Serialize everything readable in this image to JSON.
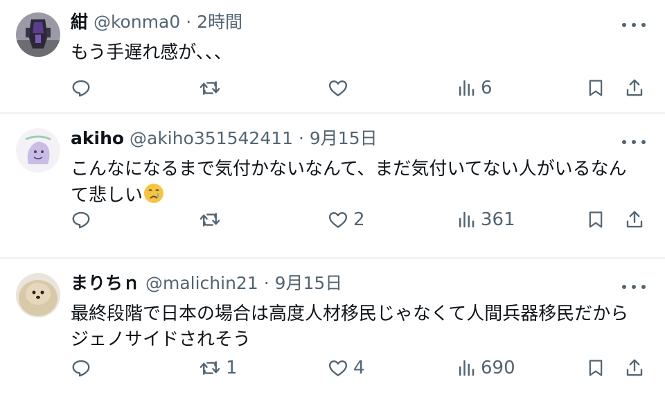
{
  "posts": [
    {
      "name": "紺",
      "handle": "@konma0",
      "separator": "·",
      "time": "2時間",
      "text": "もう手遅れ感が、、、",
      "emoji": "",
      "counts": {
        "reply": "",
        "repost": "",
        "like": "",
        "views": "6"
      }
    },
    {
      "name": "akiho",
      "handle": "@akiho351542411",
      "separator": "·",
      "time": "9月15日",
      "text_line1": "こんなになるまで気付かないなんて、まだ気付いてない人がいるなん",
      "text_line2": "て悲しい",
      "emoji": "crying-face",
      "counts": {
        "reply": "",
        "repost": "",
        "like": "2",
        "views": "361"
      }
    },
    {
      "name": "まりちｎ",
      "handle": "@malichin21",
      "separator": "·",
      "time": "9月15日",
      "text_line1": "最終段階で日本の場合は高度人材移民じゃなくて人間兵器移民だから",
      "text_line2": "ジェノサイドされそう",
      "emoji": "",
      "counts": {
        "reply": "",
        "repost": "1",
        "like": "4",
        "views": "690"
      }
    }
  ],
  "colors": {
    "text": "#0f1419",
    "secondary": "#536471",
    "divider": "#eff3f4"
  },
  "icons": [
    "reply-icon",
    "repost-icon",
    "like-icon",
    "views-icon",
    "bookmark-icon",
    "share-icon",
    "more-icon"
  ]
}
